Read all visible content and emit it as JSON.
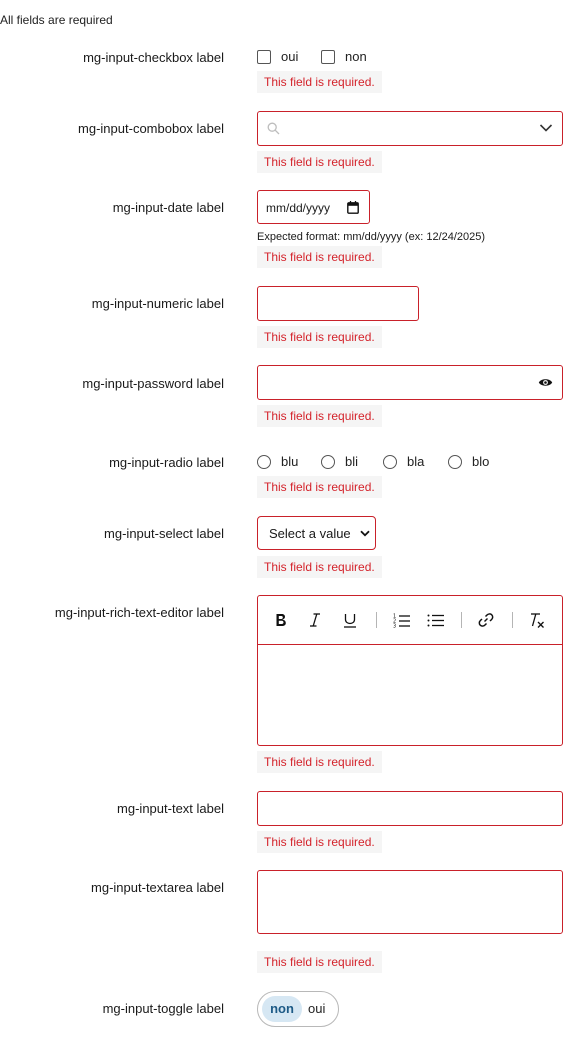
{
  "form": {
    "required_note": "All fields are required",
    "error_text": "This field is required."
  },
  "checkbox": {
    "label": "mg-input-checkbox label",
    "options": [
      "oui",
      "non"
    ]
  },
  "combobox": {
    "label": "mg-input-combobox label",
    "icons": [
      "search-icon",
      "chevron-down-icon"
    ]
  },
  "date": {
    "label": "mg-input-date label",
    "placeholder": "mm/dd/yyyy",
    "help": "Expected format: mm/dd/yyyy (ex: 12/24/2025)",
    "icon": "calendar-icon"
  },
  "numeric": {
    "label": "mg-input-numeric label"
  },
  "password": {
    "label": "mg-input-password label",
    "icon": "eye-icon"
  },
  "radio": {
    "label": "mg-input-radio label",
    "options": [
      "blu",
      "bli",
      "bla",
      "blo"
    ]
  },
  "select": {
    "label": "mg-input-select label",
    "placeholder": "Select a value"
  },
  "rich_text": {
    "label": "mg-input-rich-text-editor label",
    "toolbar": [
      "bold-icon",
      "italic-icon",
      "underline-icon",
      "ordered-list-icon",
      "bullet-list-icon",
      "link-icon",
      "clear-format-icon"
    ]
  },
  "text": {
    "label": "mg-input-text label"
  },
  "textarea": {
    "label": "mg-input-textarea label"
  },
  "toggle": {
    "label": "mg-input-toggle label",
    "options": [
      "non",
      "oui"
    ],
    "selected": "non"
  },
  "colors": {
    "error_red": "#c9212a",
    "error_text": "#d4232b",
    "error_bg": "#f5f5f5",
    "toggle_active_bg": "#d6e7f3",
    "toggle_active_text": "#1d5a86"
  }
}
